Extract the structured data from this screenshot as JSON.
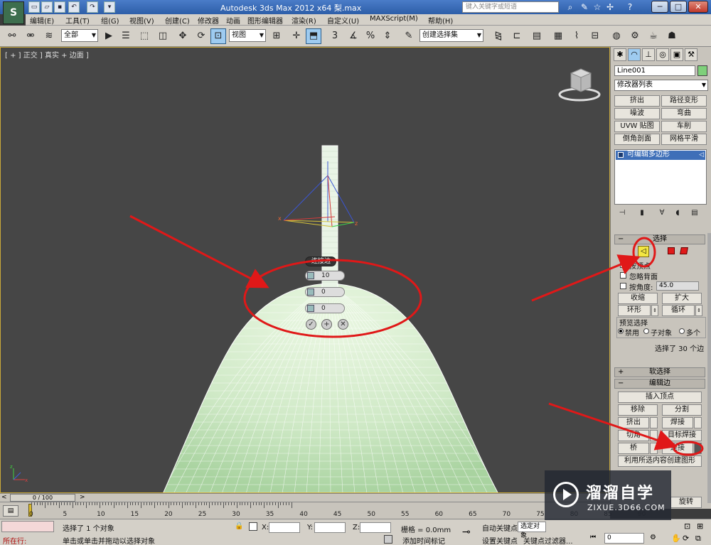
{
  "window": {
    "title": "Autodesk 3ds Max  2012 x64     梨.max",
    "logo": "S",
    "search_placeholder": "键入关键字或短语",
    "controls": [
      "─",
      "□",
      "✕"
    ]
  },
  "menu": [
    "编辑(E)",
    "工具(T)",
    "组(G)",
    "视图(V)",
    "创建(C)",
    "修改器",
    "动画",
    "图形编辑器",
    "渲染(R)",
    "自定义(U)",
    "MAXScript(M)",
    "帮助(H)"
  ],
  "toolbar": {
    "selection_filter": "全部",
    "reference_coord": "视图",
    "named_selection": "创建选择集",
    "snap_label": "3",
    "percent_snap": "%"
  },
  "viewport": {
    "label": "[ + ] 正交 ] 真实 + 边面 ]",
    "caddy": {
      "title": "连接边",
      "segments": "10",
      "pinch": "0",
      "slide": "0",
      "ok": "✓",
      "apply": "+",
      "cancel": "✕"
    }
  },
  "command_panel": {
    "object_name": "Line001",
    "object_color": "#7ed07a",
    "modifier_list": "修改器列表",
    "modifier_buttons": [
      "挤出",
      "路径变形",
      "噪波",
      "弯曲",
      "UVW 贴图",
      "车削",
      "倒角剖面",
      "网格平滑"
    ],
    "stack_item": "可编辑多边形",
    "selection": {
      "rollout": "选择",
      "by_vertex": "按顶点",
      "ignore_backfacing": "忽略背面",
      "by_angle": "按角度:",
      "angle_value": "45.0",
      "shrink": "收缩",
      "grow": "扩大",
      "ring": "环形",
      "loop": "循环",
      "preview_label": "预览选择",
      "preview_disabled": "禁用",
      "preview_subobject": "子对象",
      "preview_multi": "多个",
      "status": "选择了 30 个边"
    },
    "soft_selection": "软选择",
    "edit_edges": {
      "rollout": "编辑边",
      "insert_vertex": "插入顶点",
      "remove": "移除",
      "split": "分割",
      "extrude": "挤出",
      "weld": "焊接",
      "chamfer": "切角",
      "target_weld": "目标焊接",
      "bridge": "桥",
      "connect": "连接",
      "create_shape": "利用所选内容创建图形",
      "spin": "旋转"
    }
  },
  "timeline": {
    "frame": "0 / 100",
    "ticks": [
      "0",
      "5",
      "10",
      "15",
      "20",
      "25",
      "30",
      "35",
      "40",
      "45",
      "50",
      "55",
      "60",
      "65",
      "70",
      "75",
      "80",
      "85",
      "90"
    ]
  },
  "status": {
    "in_script": "所在行:",
    "message_1": "选择了 1 个对象",
    "message_2": "单击或单击并拖动以选择对象",
    "x_label": "X:",
    "y_label": "Y:",
    "z_label": "Z:",
    "grid": "栅格 = 0.0mm",
    "add_time_tag": "添加时间标记",
    "auto_key": "自动关键点",
    "selected_objects": "选定对象",
    "set_key": "设置关键点",
    "key_filters": "关键点过滤器...",
    "frame_field": "0"
  },
  "watermark": {
    "title": "溜溜自学",
    "subtitle": "ZIXUE.3D66.COM"
  }
}
